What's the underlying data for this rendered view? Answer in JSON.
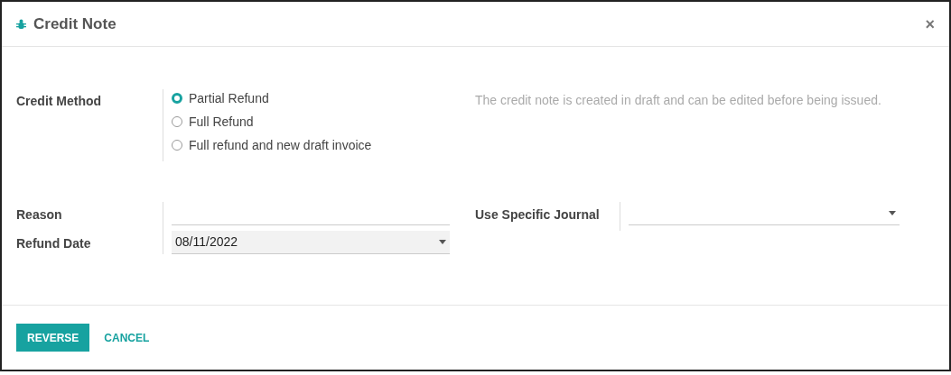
{
  "dialog": {
    "title": "Credit Note",
    "close": "×"
  },
  "credit_method": {
    "label": "Credit Method",
    "options": [
      {
        "label": "Partial Refund",
        "selected": true
      },
      {
        "label": "Full Refund",
        "selected": false
      },
      {
        "label": "Full refund and new draft invoice",
        "selected": false
      }
    ],
    "help": "The credit note is created in draft and can be edited before being issued."
  },
  "reason": {
    "label": "Reason"
  },
  "refund_date": {
    "label": "Refund Date",
    "value": "08/11/2022"
  },
  "journal": {
    "label": "Use Specific Journal"
  },
  "buttons": [
    {
      "label": "REVERSE",
      "kind": "primary"
    },
    {
      "label": "CANCEL",
      "kind": "link"
    }
  ]
}
